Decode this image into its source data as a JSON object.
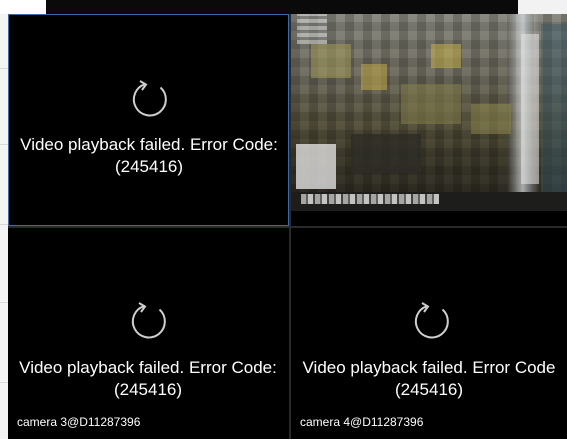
{
  "cells": [
    {
      "id": 1,
      "state": "error",
      "error_text": "Video playback failed. Error Code:",
      "error_code": "(245416)",
      "camera_label": ""
    },
    {
      "id": 2,
      "state": "playing",
      "camera_label": ""
    },
    {
      "id": 3,
      "state": "error",
      "error_text": "Video playback failed. Error Code:",
      "error_code": "(245416)",
      "camera_label": "camera 3@D11287396"
    },
    {
      "id": 4,
      "state": "error",
      "error_text": "Video playback failed. Error Code",
      "error_code": "(245416)",
      "camera_label": "camera 4@D11287396"
    }
  ],
  "colors": {
    "background": "#000000",
    "selected_border": "#3d6aa6",
    "text": "#ffffff",
    "icon": "#cfcfcf"
  },
  "icons": {
    "reload": "reload-icon"
  }
}
